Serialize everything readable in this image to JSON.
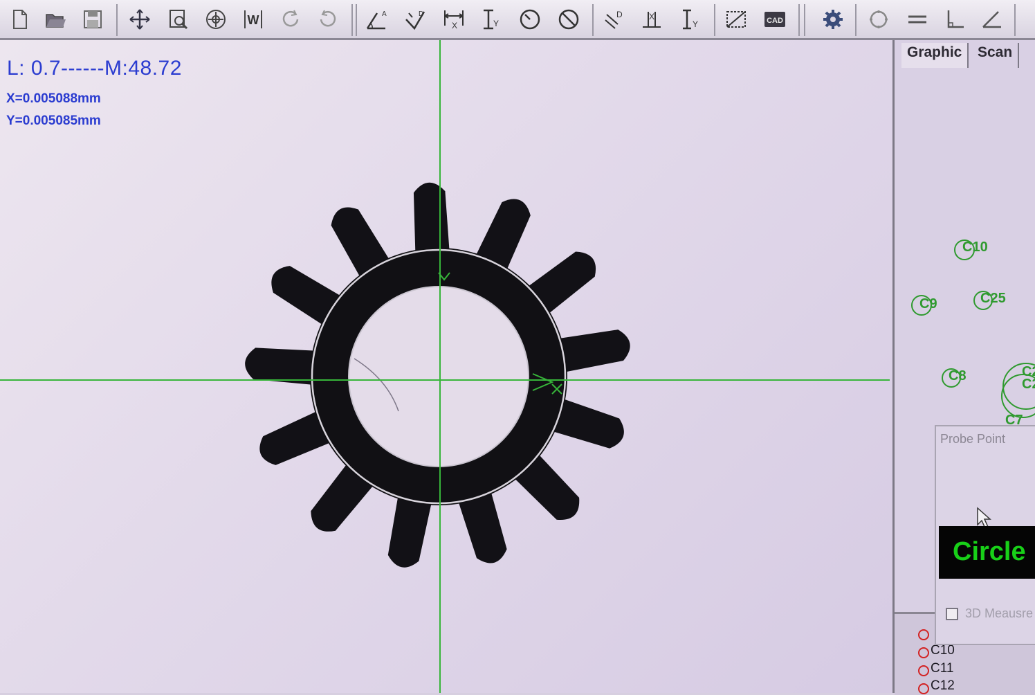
{
  "toolbar": {
    "icons": [
      "new-file-icon",
      "open-folder-icon",
      "save-icon",
      "move-icon",
      "zoom-window-icon",
      "zoom-all-icon",
      "w-icon",
      "undo-icon",
      "redo-icon",
      "angle-a-icon",
      "angle-d-icon",
      "distance-x-icon",
      "distance-y-icon",
      "circle-measure-icon",
      "circle-diameter-icon",
      "distance-d-icon",
      "distance-x2-icon",
      "distance-y2-icon",
      "rectangle-icon",
      "cad-icon",
      "settings-gear-icon",
      "circle-fit-icon",
      "parallel-icon",
      "perpendicular-icon",
      "angle-icon"
    ],
    "cad_label": "CAD"
  },
  "readout": {
    "main": "L: 0.7------M:48.72",
    "x": "X=0.005088mm",
    "y": "Y=0.005085mm"
  },
  "tabs": [
    "Graphic",
    "Scan"
  ],
  "features": [
    {
      "label": "C10"
    },
    {
      "label": "C9"
    },
    {
      "label": "C25"
    },
    {
      "label": "C8"
    },
    {
      "label": "C2"
    },
    {
      "label": "C2"
    },
    {
      "label": "C7"
    }
  ],
  "probe": {
    "title": "Probe Point",
    "mode": "Circle",
    "checkbox_label": "3D Meausre"
  },
  "feature_list": [
    "C10",
    "C11",
    "C12"
  ],
  "colors": {
    "readout": "#2b3cd0",
    "crosshair": "#37b53a",
    "mode_text": "#18d018",
    "feature": "#2f9a2f",
    "list_icon": "#d32222"
  }
}
